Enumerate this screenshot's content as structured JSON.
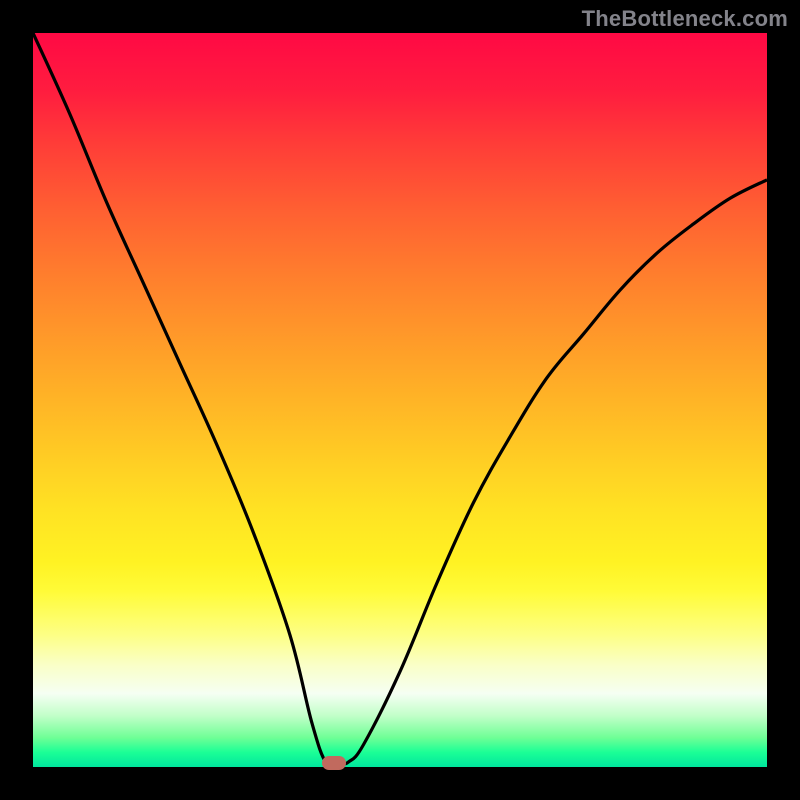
{
  "watermark": "TheBottleneck.com",
  "colors": {
    "frame": "#000000",
    "curve": "#000000",
    "marker": "#c16a5e"
  },
  "chart_data": {
    "type": "line",
    "title": "",
    "xlabel": "",
    "ylabel": "",
    "xlim": [
      0,
      100
    ],
    "ylim": [
      0,
      100
    ],
    "grid": false,
    "series": [
      {
        "name": "bottleneck-curve",
        "x": [
          0,
          5,
          10,
          15,
          20,
          25,
          30,
          35,
          38,
          40,
          42,
          43,
          45,
          50,
          55,
          60,
          65,
          70,
          75,
          80,
          85,
          90,
          95,
          100
        ],
        "values": [
          100,
          89,
          77,
          66,
          55,
          44,
          32,
          18,
          6,
          0.5,
          0.5,
          0.7,
          3,
          13,
          25,
          36,
          45,
          53,
          59,
          65,
          70,
          74,
          77.5,
          80
        ]
      }
    ],
    "marker": {
      "x": 41,
      "y": 0.5
    },
    "gradient_stops": [
      {
        "pos": 0,
        "color": "#ff0944"
      },
      {
        "pos": 50,
        "color": "#ffb426"
      },
      {
        "pos": 76,
        "color": "#fffb37"
      },
      {
        "pos": 100,
        "color": "#00e69d"
      }
    ]
  }
}
